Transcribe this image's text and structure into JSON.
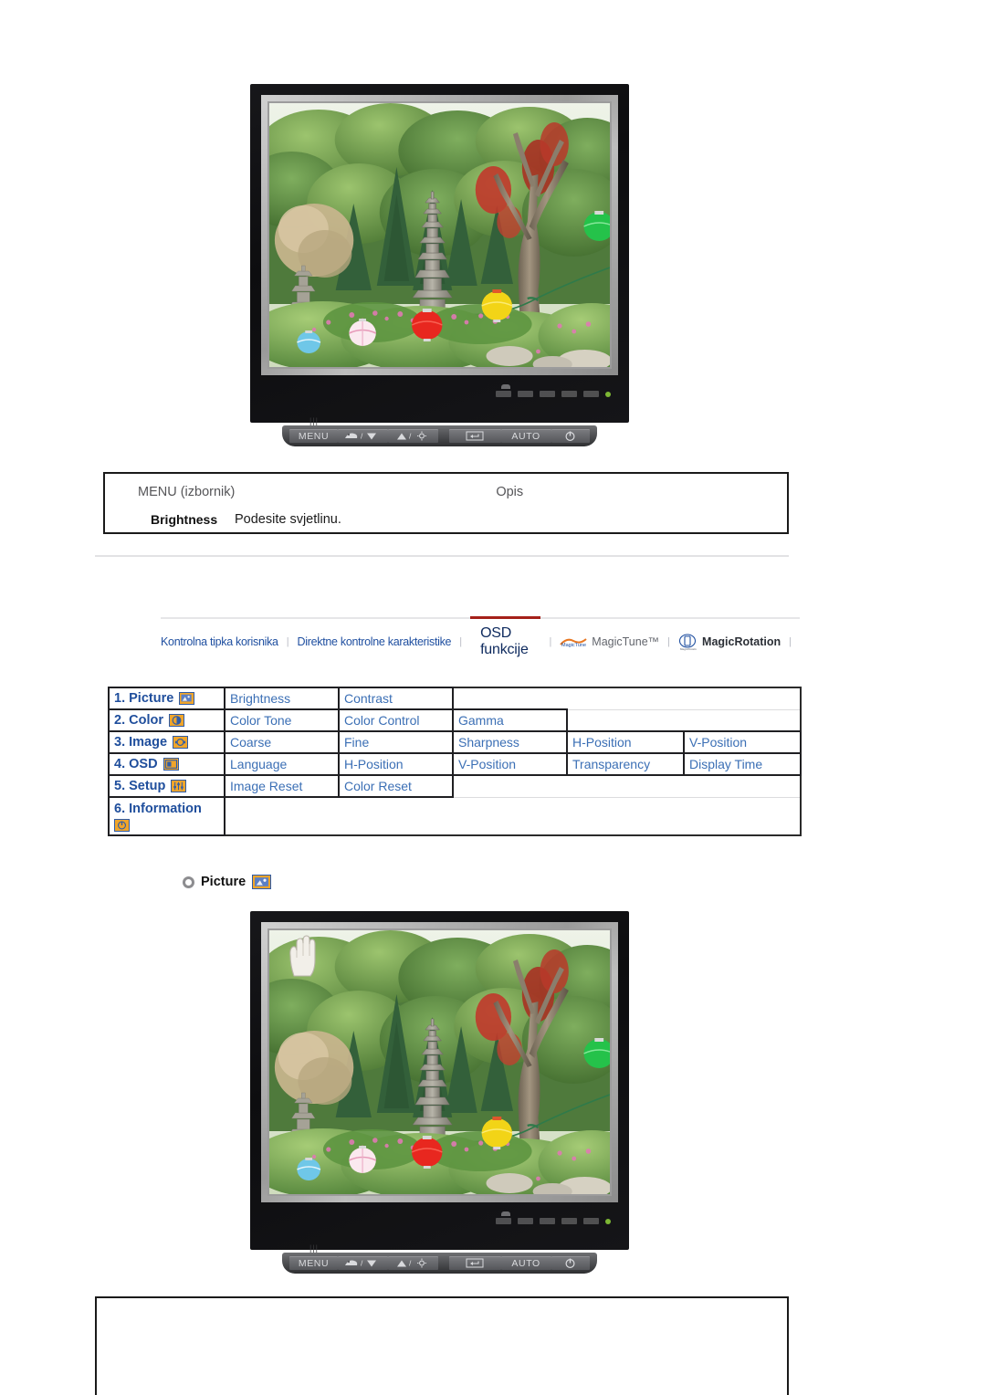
{
  "page": {
    "language": "Croatian",
    "background": "#ffffff"
  },
  "monitor_top": {
    "name": "samsung-lcd-monitor",
    "screen_image_alt": "Korean garden with stone pagoda, trees and colorful paper lanterns",
    "buttons": {
      "menu": "MENU",
      "down": "/",
      "up": "/",
      "enter": "",
      "auto": "AUTO",
      "power": ""
    }
  },
  "desc_table": {
    "header_menu": "MENU (izbornik)",
    "header_desc": "Opis",
    "rows": [
      {
        "name": "Brightness",
        "description": "Podesite svjetlinu."
      }
    ]
  },
  "tabbar": {
    "tabs": [
      {
        "label": "Kontrolna tipka korisnika",
        "style": "link",
        "active": false
      },
      {
        "label": "Direktne kontrolne karakteristike",
        "style": "link",
        "active": false
      },
      {
        "label": "OSD funkcije",
        "style": "active",
        "active": true
      },
      {
        "label": "MagicTune™",
        "style": "gray",
        "active": false,
        "icon": "magictune-logo-icon"
      },
      {
        "label": "MagicRotation",
        "style": "dark",
        "active": false,
        "icon": "magicrotation-logo-icon"
      }
    ],
    "separator": "|"
  },
  "osd_menu": {
    "rows": [
      {
        "category": "1. Picture",
        "icon": "picture-icon",
        "items": [
          "Brightness",
          "Contrast"
        ]
      },
      {
        "category": "2. Color",
        "icon": "color-icon",
        "items": [
          "Color Tone",
          "Color Control",
          "Gamma"
        ]
      },
      {
        "category": "3. Image",
        "icon": "image-icon",
        "items": [
          "Coarse",
          "Fine",
          "Sharpness",
          "H-Position",
          "V-Position"
        ]
      },
      {
        "category": "4. OSD",
        "icon": "osd-icon",
        "items": [
          "Language",
          "H-Position",
          "V-Position",
          "Transparency",
          "Display Time"
        ]
      },
      {
        "category": "5. Setup",
        "icon": "setup-icon",
        "items": [
          "Image Reset",
          "Color Reset"
        ]
      },
      {
        "category": "6. Information",
        "icon": "information-icon",
        "items": []
      }
    ]
  },
  "section_heading": {
    "label": "Picture",
    "icon": "picture-icon"
  },
  "monitor_bottom": {
    "name": "samsung-lcd-monitor",
    "screen_image_alt": "Korean garden with stone pagoda, trees and colorful paper lanterns",
    "cursor": "hand-pointer-icon",
    "cursor_target": "MENU",
    "buttons": {
      "menu": "MENU",
      "down": "/",
      "up": "/",
      "enter": "",
      "auto": "AUTO",
      "power": ""
    }
  },
  "colors": {
    "tab_link": "#1f4fa0",
    "tab_active": "#0e2a5e",
    "tab_accent_bar": "#a52019",
    "table_text": "#3b6fb5",
    "icon_fill": "#f0a52a",
    "icon_border": "#2f5ca8",
    "border": "#1a1a1a"
  }
}
